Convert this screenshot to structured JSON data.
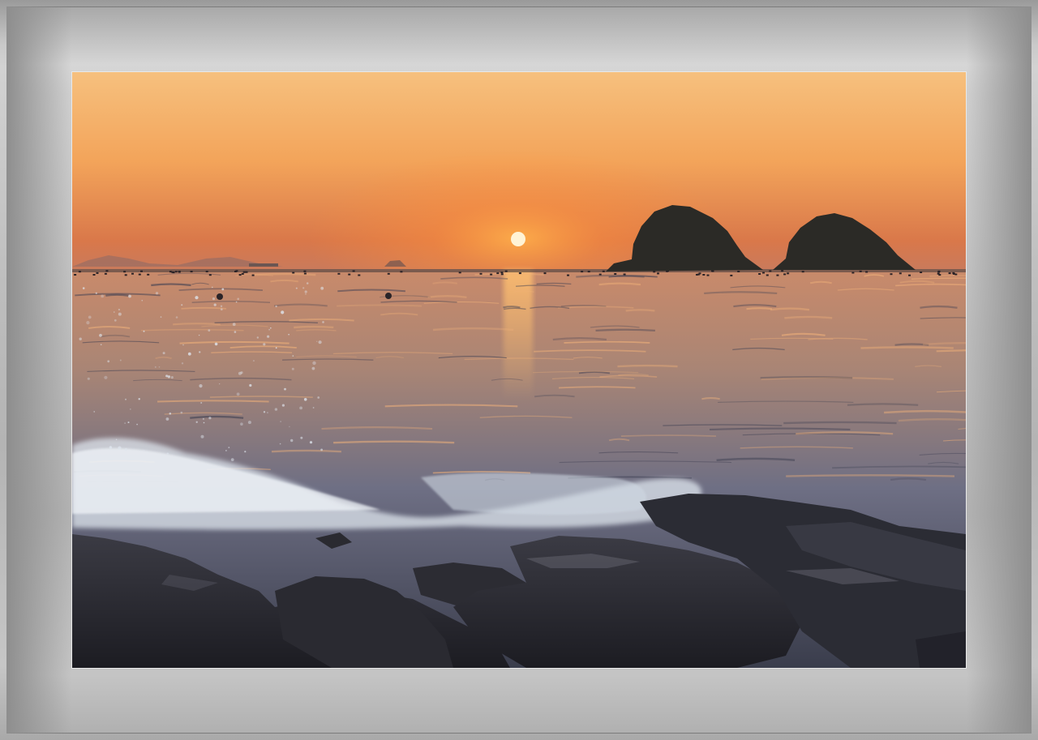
{
  "scene": {
    "subject": "sunset-over-sea-with-rock-islets",
    "colors": {
      "sky_top": "#f6c07e",
      "sky_mid": "#f3a45a",
      "sky_horizon": "#d9784a",
      "haze": "#c97a5c",
      "sun": "#fff3d6",
      "sun_glow": "#ff9a3a",
      "water_far": "#c98a6a",
      "water_mid": "#6e6f84",
      "water_near": "#3a3d4c",
      "foam": "#dfe6ee",
      "rock": "#2a2a30",
      "islet": "#2b2a26",
      "mat_light": "#d2d2d2",
      "mat_dark": "#8a8a8a"
    }
  }
}
